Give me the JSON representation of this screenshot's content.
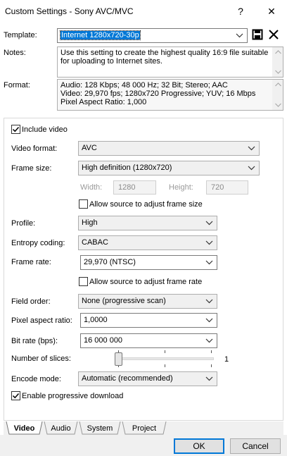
{
  "window": {
    "title": "Custom Settings - Sony AVC/MVC",
    "help_glyph": "?",
    "close_glyph": "✕"
  },
  "template": {
    "label": "Template:",
    "value": "Internet 1280x720-30p"
  },
  "notes": {
    "label": "Notes:",
    "text": "Use this setting to create the highest quality 16:9 file suitable for uploading to Internet sites."
  },
  "format": {
    "label": "Format:",
    "lines": [
      "Audio: 128 Kbps; 48 000 Hz; 32 Bit; Stereo; AAC",
      "Video: 29,970 fps; 1280x720 Progressive; YUV; 16 Mbps",
      "Pixel Aspect Ratio: 1,000"
    ]
  },
  "video": {
    "include_video_label": "Include video",
    "include_video_checked": true,
    "video_format": {
      "label": "Video format:",
      "value": "AVC"
    },
    "frame_size": {
      "label": "Frame size:",
      "value": "High definition (1280x720)"
    },
    "width": {
      "label": "Width:",
      "value": "1280"
    },
    "height": {
      "label": "Height:",
      "value": "720"
    },
    "allow_adjust_frame_size_label": "Allow source to adjust frame size",
    "allow_adjust_frame_size_checked": false,
    "profile": {
      "label": "Profile:",
      "value": "High"
    },
    "entropy_coding": {
      "label": "Entropy coding:",
      "value": "CABAC"
    },
    "frame_rate": {
      "label": "Frame rate:",
      "value": "29,970 (NTSC)"
    },
    "allow_adjust_frame_rate_label": "Allow source to adjust frame rate",
    "allow_adjust_frame_rate_checked": false,
    "field_order": {
      "label": "Field order:",
      "value": "None (progressive scan)"
    },
    "pixel_aspect_ratio": {
      "label": "Pixel aspect ratio:",
      "value": "1,0000"
    },
    "bit_rate": {
      "label": "Bit rate (bps):",
      "value": "16 000 000"
    },
    "slices": {
      "label": "Number of slices:",
      "value": "1",
      "slider_fraction": 0.0
    },
    "encode_mode": {
      "label": "Encode mode:",
      "value": "Automatic (recommended)"
    },
    "progressive_download_label": "Enable progressive download",
    "progressive_download_checked": true
  },
  "tabs": [
    {
      "label": "Video",
      "active": true
    },
    {
      "label": "Audio",
      "active": false
    },
    {
      "label": "System",
      "active": false
    },
    {
      "label": "Project",
      "active": false
    }
  ],
  "buttons": {
    "ok_label": "OK",
    "cancel_label": "Cancel"
  },
  "icons": {
    "save": "save-icon",
    "delete": "delete-icon"
  }
}
